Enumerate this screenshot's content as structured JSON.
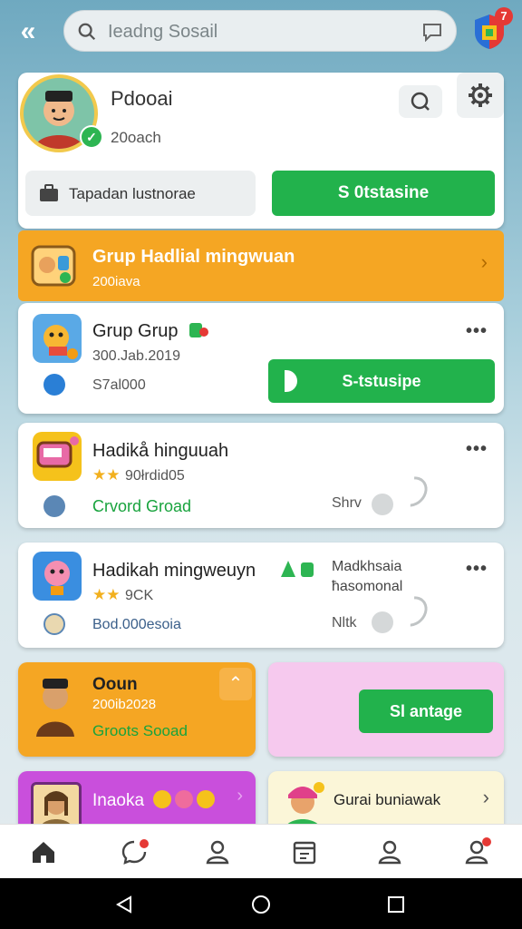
{
  "header": {
    "search_placeholder": "Ieadng Sosail",
    "notification_badge": "7"
  },
  "profile": {
    "name": "Pdooai",
    "subtitle": "20oach",
    "action_left_label": "Tapadan lustnorae",
    "action_right_label": "S 0tstasine"
  },
  "banner": {
    "title": "Grup Hadlial mingwuan",
    "subtitle": "200iava"
  },
  "rows": [
    {
      "title": "Grup Grup",
      "subtitle": "300.Jab.2019",
      "meta": "S7al000",
      "button_label": "S-tstusipe"
    },
    {
      "title": "Hadikå hinguuah",
      "rating_text": "90łrdid05",
      "link_text": "Crvord Groad",
      "side_label": "Shrv"
    },
    {
      "title": "Hadikah mingweuyn",
      "rating_text": "9CK",
      "meta": "Bod.000esoia",
      "side_line1": "Madkhsaia",
      "side_line2": "ħasomonal",
      "side_label": "Nltk"
    }
  ],
  "tiles": {
    "orange": {
      "title": "Ooun",
      "subtitle": "200ib2028",
      "link_text": "Groots Sooad"
    },
    "pink_button_label": "Sl antage",
    "purple_title": "Inaoka",
    "cream_title": "Gurai buniawak"
  },
  "colors": {
    "accent_green": "#22b24c",
    "banner_orange": "#f5a623",
    "purple": "#c94fdc",
    "pink": "#f6c9ee",
    "cream": "#fbf6d8"
  }
}
